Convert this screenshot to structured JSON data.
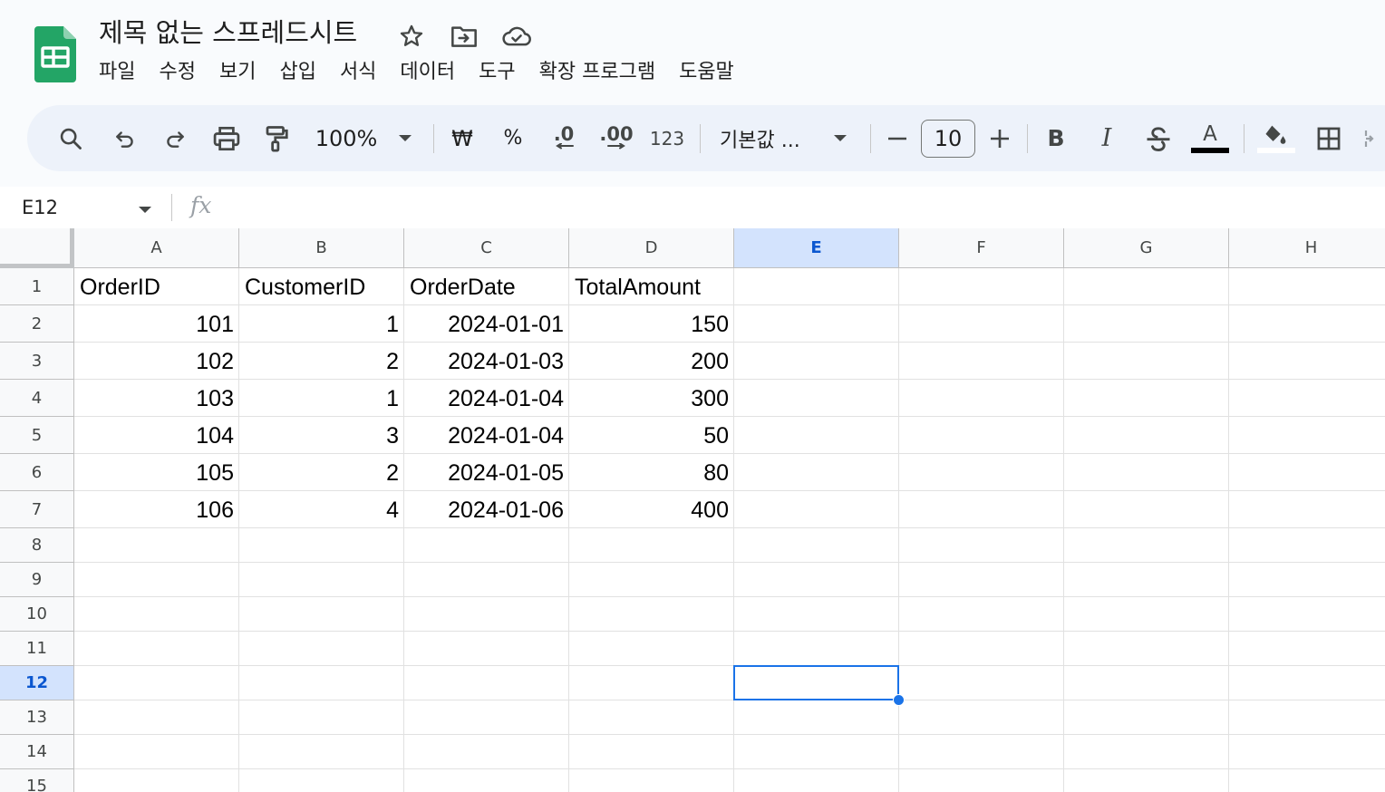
{
  "app": {
    "doc_title": "제목 없는 스프레드시트",
    "menu": [
      "파일",
      "수정",
      "보기",
      "삽입",
      "서식",
      "데이터",
      "도구",
      "확장 프로그램",
      "도움말"
    ]
  },
  "toolbar": {
    "zoom": "100%",
    "currency": "₩",
    "percent": "%",
    "decrease_decimal": ".0",
    "increase_decimal": ".00",
    "number_format": "123",
    "font": "기본값 ...",
    "font_size": "10",
    "bold": "B",
    "italic": "I",
    "text_color_letter": "A",
    "colors": {
      "text_color": "#000000",
      "fill_color": "#ffffff"
    }
  },
  "formula_bar": {
    "name_box": "E12",
    "fx": "fx"
  },
  "sheet": {
    "columns": [
      "A",
      "B",
      "C",
      "D",
      "E",
      "F",
      "G",
      "H"
    ],
    "rows": [
      "1",
      "2",
      "3",
      "4",
      "5",
      "6",
      "7",
      "8",
      "9",
      "10",
      "11",
      "12",
      "13",
      "14",
      "15"
    ],
    "selected_column": "E",
    "selected_row": "12",
    "cells": [
      [
        "OrderID",
        "CustomerID",
        "OrderDate",
        "TotalAmount"
      ],
      [
        "101",
        "1",
        "2024-01-01",
        "150"
      ],
      [
        "102",
        "2",
        "2024-01-03",
        "200"
      ],
      [
        "103",
        "1",
        "2024-01-04",
        "300"
      ],
      [
        "104",
        "3",
        "2024-01-04",
        "50"
      ],
      [
        "105",
        "2",
        "2024-01-05",
        "80"
      ],
      [
        "106",
        "4",
        "2024-01-06",
        "400"
      ]
    ],
    "colors": {
      "selection": "#1a73e8",
      "selected_header": "#d3e3fd"
    }
  }
}
